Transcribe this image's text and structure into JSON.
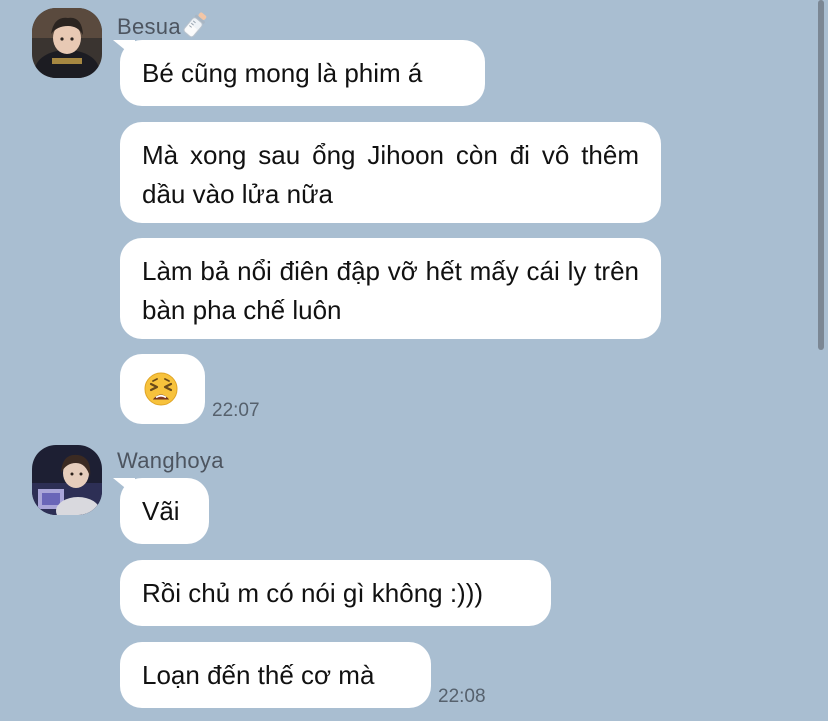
{
  "messages_group_1": {
    "sender": "Besua",
    "sender_icon": "baby-bottle-icon",
    "messages": [
      "Bé cũng mong là phim á",
      "Mà xong sau ổng Jihoon còn đi vô thêm dầu vào lửa nữa",
      "Làm bả nổi điên đập vỡ hết mấy cái ly trên bàn pha chế luôn"
    ],
    "emoji_message": "tired-face-emoji",
    "time": "22:07"
  },
  "messages_group_2": {
    "sender": "Wanghoya",
    "messages": [
      "Vãi",
      "Rồi chủ m có nói gì không :)))",
      "Loạn đến thế cơ mà"
    ],
    "time": "22:08"
  },
  "colors": {
    "background": "#a9bed1",
    "bubble": "#ffffff",
    "text": "#111111",
    "meta_text": "#56616d"
  }
}
